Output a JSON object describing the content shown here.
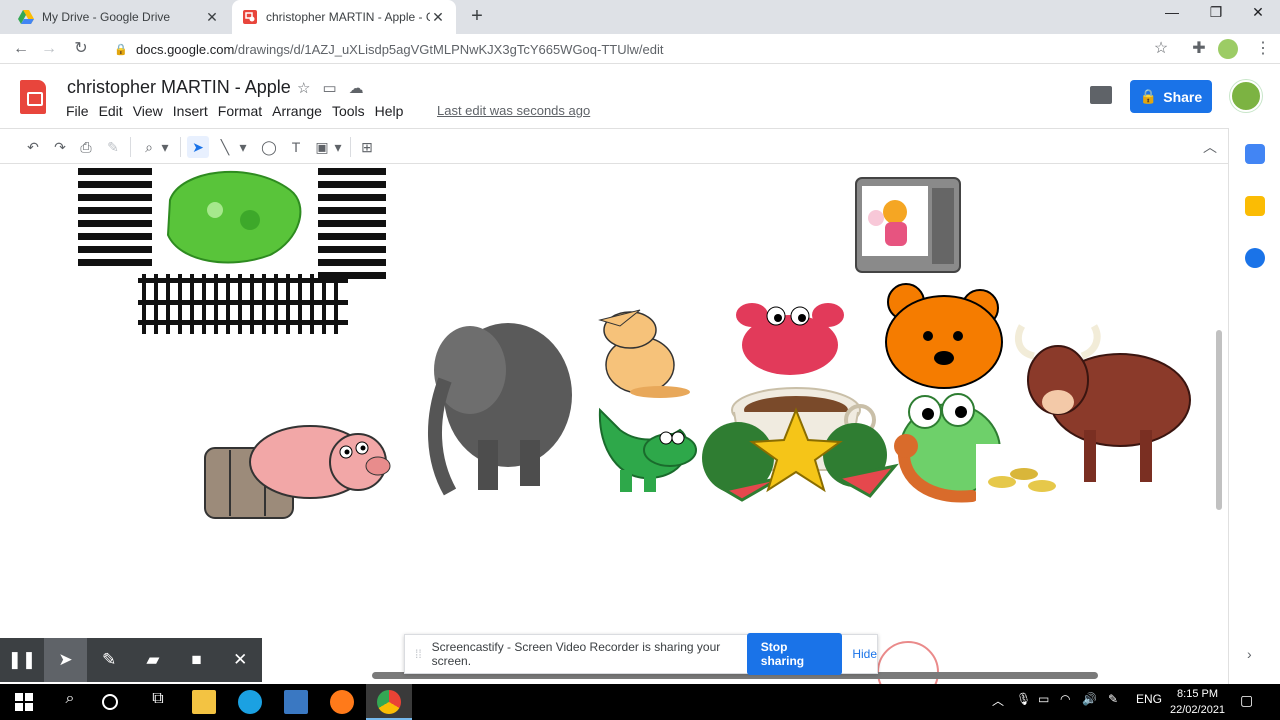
{
  "browser": {
    "tabs": [
      {
        "title": "My Drive - Google Drive"
      },
      {
        "title": "christopher MARTIN - Apple - Go"
      }
    ],
    "url_host": "docs.google.com",
    "url_path": "/drawings/d/1AZJ_uXLisdp5agVGtMLPNwKJX3gTcY665WGoq-TTUlw/edit"
  },
  "doc": {
    "title": "christopher MARTIN - Apple",
    "menu": [
      "File",
      "Edit",
      "View",
      "Insert",
      "Format",
      "Arrange",
      "Tools",
      "Help"
    ],
    "last_edit": "Last edit was seconds ago",
    "share_label": "Share"
  },
  "screencastify": {
    "message": "Screencastify - Screen Video Recorder is sharing your screen.",
    "stop_label": "Stop sharing",
    "hide_label": "Hide"
  },
  "taskbar": {
    "language": "ENG",
    "time": "8:15 PM",
    "date": "22/02/2021"
  },
  "colors": {
    "accent": "#1a73e8",
    "docs_red": "#e8453c"
  }
}
